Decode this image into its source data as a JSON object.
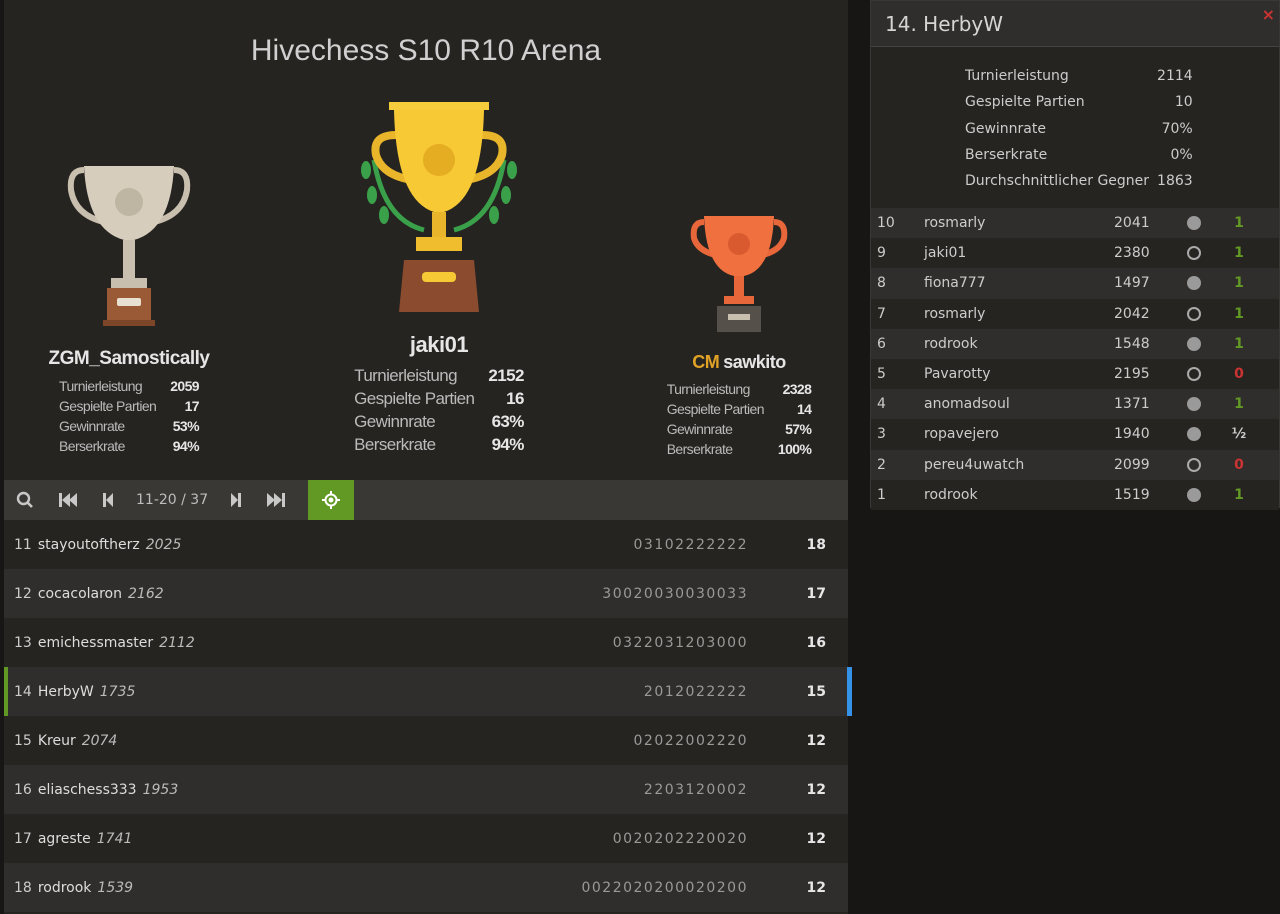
{
  "title": "Hivechess S10 R10 Arena",
  "podium": {
    "second": {
      "name": "ZGM_Samostically",
      "stats": [
        [
          "Turnierleistung",
          "2059"
        ],
        [
          "Gespielte Partien",
          "17"
        ],
        [
          "Gewinnrate",
          "53%"
        ],
        [
          "Berserkrate",
          "94%"
        ]
      ]
    },
    "first": {
      "name": "jaki01",
      "stats": [
        [
          "Turnierleistung",
          "2152"
        ],
        [
          "Gespielte Partien",
          "16"
        ],
        [
          "Gewinnrate",
          "63%"
        ],
        [
          "Berserkrate",
          "94%"
        ]
      ]
    },
    "third": {
      "title": "CM",
      "name": "sawkito",
      "stats": [
        [
          "Turnierleistung",
          "2328"
        ],
        [
          "Gespielte Partien",
          "14"
        ],
        [
          "Gewinnrate",
          "57%"
        ],
        [
          "Berserkrate",
          "100%"
        ]
      ]
    }
  },
  "pager": {
    "info": "11-20 / 37"
  },
  "standings": [
    {
      "rank": "11",
      "name": "stayoutoftherz",
      "rating": "2025",
      "sheet": "03102222222",
      "total": "18"
    },
    {
      "rank": "12",
      "name": "cocacolaron",
      "rating": "2162",
      "sheet": "30020030030033",
      "total": "17"
    },
    {
      "rank": "13",
      "name": "emichessmaster",
      "rating": "2112",
      "sheet": "0322031203000",
      "total": "16"
    },
    {
      "rank": "14",
      "name": "HerbyW",
      "rating": "1735",
      "sheet": "2012022222",
      "total": "15"
    },
    {
      "rank": "15",
      "name": "Kreur",
      "rating": "2074",
      "sheet": "02022002220",
      "total": "12"
    },
    {
      "rank": "16",
      "name": "eliaschess333",
      "rating": "1953",
      "sheet": "2203120002",
      "total": "12"
    },
    {
      "rank": "17",
      "name": "agreste",
      "rating": "1741",
      "sheet": "0020202220020",
      "total": "12"
    },
    {
      "rank": "18",
      "name": "rodrook",
      "rating": "1539",
      "sheet": "0022020200020200",
      "total": "12"
    }
  ],
  "player": {
    "title": "14. HerbyW",
    "close": "×",
    "stats": [
      [
        "Turnierleistung",
        "2114"
      ],
      [
        "Gespielte Partien",
        "10"
      ],
      [
        "Gewinnrate",
        "70%"
      ],
      [
        "Berserkrate",
        "0%"
      ],
      [
        "Durchschnittlicher Gegner",
        "1863"
      ]
    ],
    "games": [
      {
        "n": "10",
        "opp": "rosmarly",
        "rating": "2041",
        "color": "white",
        "res": "1"
      },
      {
        "n": "9",
        "opp": "jaki01",
        "rating": "2380",
        "color": "black",
        "res": "1"
      },
      {
        "n": "8",
        "opp": "fiona777",
        "rating": "1497",
        "color": "white",
        "res": "1"
      },
      {
        "n": "7",
        "opp": "rosmarly",
        "rating": "2042",
        "color": "black",
        "res": "1"
      },
      {
        "n": "6",
        "opp": "rodrook",
        "rating": "1548",
        "color": "white",
        "res": "1"
      },
      {
        "n": "5",
        "opp": "Pavarotty",
        "rating": "2195",
        "color": "black",
        "res": "0"
      },
      {
        "n": "4",
        "opp": "anomadsoul",
        "rating": "1371",
        "color": "white",
        "res": "1"
      },
      {
        "n": "3",
        "opp": "ropavejero",
        "rating": "1940",
        "color": "white",
        "res": "½"
      },
      {
        "n": "2",
        "opp": "pereu4uwatch",
        "rating": "2099",
        "color": "black",
        "res": "0"
      },
      {
        "n": "1",
        "opp": "rodrook",
        "rating": "1519",
        "color": "white",
        "res": "1"
      }
    ]
  },
  "colors": {
    "win": "#629924",
    "loss": "#cc3333",
    "draw": "#cccccc",
    "accent": "#629924",
    "highlight": "#3692e7"
  }
}
